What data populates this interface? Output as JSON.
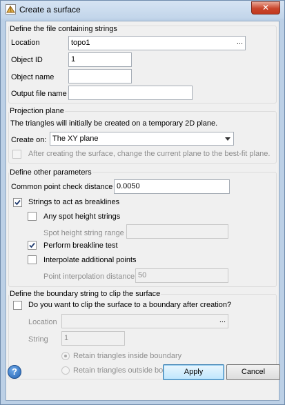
{
  "window": {
    "title": "Create a surface",
    "close_glyph": "✕"
  },
  "group_strings": {
    "title": "Define the file containing strings",
    "location_label": "Location",
    "location_value": "topo1",
    "browse": "...",
    "object_id_label": "Object ID",
    "object_id_value": "1",
    "object_name_label": "Object name",
    "object_name_value": "",
    "output_file_label": "Output file name",
    "output_file_value": ""
  },
  "group_projection": {
    "title": "Projection plane",
    "info": "The triangles will initially be created on a temporary 2D plane.",
    "create_on_label": "Create on:",
    "create_on_value": "The XY plane",
    "best_fit_label": "After creating the surface, change the current plane to the best-fit plane."
  },
  "group_params": {
    "title": "Define other parameters",
    "common_point_label": "Common point check distance",
    "common_point_value": "0.0050",
    "breaklines_label": "Strings to act as breaklines",
    "spot_height_label": "Any spot height strings",
    "spot_range_label": "Spot height string range",
    "spot_range_value": "",
    "breakline_test_label": "Perform breakline test",
    "interpolate_label": "Interpolate additional points",
    "interp_distance_label": "Point interpolation distance",
    "interp_distance_value": "50"
  },
  "group_boundary": {
    "title": "Define the boundary string to clip the surface",
    "clip_label": "Do you want to clip the surface to a boundary after creation?",
    "location_label": "Location",
    "location_value": "",
    "browse": "...",
    "string_label": "String",
    "string_value": "1",
    "retain_inside_label": "Retain triangles inside boundary",
    "retain_outside_label": "Retain triangles outside boundary"
  },
  "footer": {
    "help": "?",
    "apply": "Apply",
    "cancel": "Cancel"
  },
  "colors": {
    "accent": "#3c7fb1",
    "close": "#c9462c",
    "titlebar": "#c2d5ea"
  }
}
